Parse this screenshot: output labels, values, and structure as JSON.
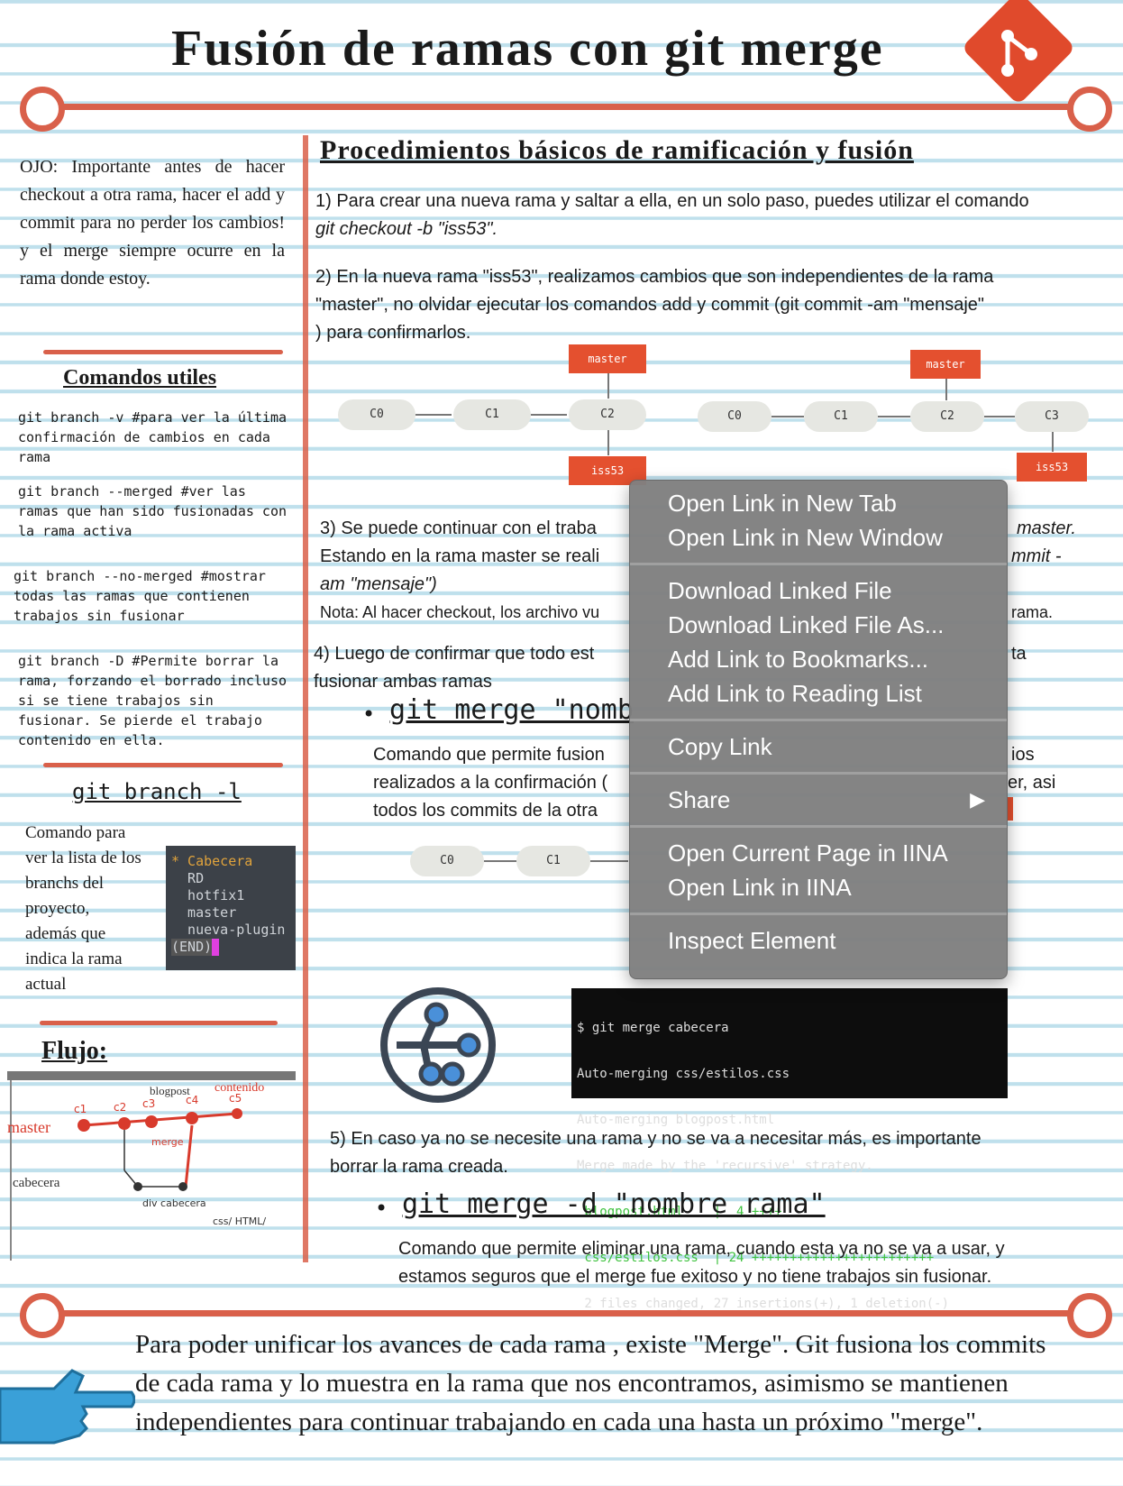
{
  "title": "Fusión de ramas con git merge",
  "left": {
    "note": "OJO: Importante antes de hacer checkout a otra rama, hacer el add y commit para no perder los cambios! y el merge siempre ocurre en la rama donde estoy.",
    "commands_title": "Comandos utiles",
    "cmd1": "git branch -v #para ver la última confirmación de cambios en cada rama",
    "cmd2": "git branch --merged #ver las ramas que han sido fusionadas con la rama activa",
    "cmd3": "git branch --no-merged #mostrar todas las ramas que contienen trabajos sin fusionar",
    "cmd4": "git branch -D #Permite borrar la rama, forzando el borrado incluso si se tiene trabajos sin fusionar. Se pierde el trabajo contenido en ella.",
    "branch_l_title": "git branch -l",
    "branch_l_desc": [
      "Comando para",
      "ver la lista de los",
      "branchs del",
      "proyecto,",
      "además que",
      "indica la rama",
      "actual"
    ],
    "branch_list": [
      "* Cabecera",
      "  RD",
      "  hotfix1",
      "  master",
      "  nueva-plugin",
      "(END)"
    ],
    "flujo_title": "Flujo:",
    "flow_labels": {
      "master": "master",
      "cabecera": "cabecera",
      "c1": "c1",
      "c2": "c2",
      "c3": "c3",
      "c4": "c4",
      "c5": "c5",
      "blogpost": "blogpost",
      "contenido": "contenido",
      "merge": "merge",
      "div_cabecera": "div cabecera",
      "css": "css/ HTML/"
    }
  },
  "main": {
    "section_title": "Procedimientos básicos de ramificación y fusión",
    "p1a": "1) Para crear una nueva rama y saltar a ella, en un solo paso, puedes utilizar el comando",
    "p1b": "git checkout -b \"iss53\".",
    "p2a": "2) En la nueva rama \"iss53\", realizamos cambios que son independientes de la rama",
    "p2b": "\"master\", no olvidar ejecutar los comandos add y commit (git commit -am \"mensaje\"",
    "p2c": ") para confirmarlos.",
    "p3a": "3) Se puede continuar con el traba",
    "p3a_r": "master.",
    "p3b": "Estando en la rama master se reali",
    "p3b_r": "mmit -",
    "p3c": "am \"mensaje\")",
    "p3d": "Nota: Al hacer checkout, los archivo vu",
    "p3d_r": "rama.",
    "p4a": "4) Luego de confirmar que todo est",
    "p4a_r": "ta",
    "p4b": "fusionar ambas ramas",
    "cmd_merge": "git merge \"nomb",
    "p4c": "Comando que permite fusion",
    "p4c_r": "ios",
    "p4d": "realizados a la confirmación (",
    "p4d_r": "er, asi",
    "p4e": "todos los commits de la otra",
    "p5a": "5) En caso ya no se necesite una rama y no se va a necesitar más, es importante",
    "p5b": "borrar la rama creada.",
    "cmd_delete": "git merge -d \"nombre rama\"",
    "p5c": "Comando que permite eliminar una rama, cuando esta ya no se va a usar, y",
    "p5d": "estamos seguros que el merge fue exitoso y no tiene trabajos sin fusionar.",
    "diagram1": {
      "nodes": [
        "C0",
        "C1",
        "C2"
      ],
      "top_tag": "master",
      "bottom_tag": "iss53"
    },
    "diagram2": {
      "nodes": [
        "C0",
        "C1",
        "C2",
        "C3"
      ],
      "top_tag": "master",
      "bottom_tag": "iss53"
    },
    "diagram3": {
      "nodes": [
        "C0",
        "C1"
      ]
    },
    "terminal": [
      "$ git merge cabecera",
      "Auto-merging css/estilos.css",
      "Auto-merging blogpost.html",
      "Merge made by the 'recursive' strategy.",
      " blogpost.html    |  4 ++++",
      " css/estilos.css  | 24 ++++++++++++++++++++++++",
      " 2 files changed, 27 insertions(+), 1 deletion(-)"
    ]
  },
  "bottom": {
    "summary": "Para poder unificar los avances de cada rama , existe \"Merge\". Git fusiona los commits de cada rama y lo muestra en la rama que nos encontramos, asimismo se mantienen independientes para continuar trabajando en cada una hasta un próximo \"merge\"."
  },
  "context_menu": {
    "group1": [
      "Open Link in New Tab",
      "Open Link in New Window"
    ],
    "group2": [
      "Download Linked File",
      "Download Linked File As...",
      "Add Link to Bookmarks...",
      "Add Link to Reading List"
    ],
    "group3": [
      "Copy Link"
    ],
    "group4": [
      "Share"
    ],
    "group5": [
      "Open Current Page in IINA",
      "Open Link in IINA"
    ],
    "group6": [
      "Inspect Element"
    ]
  },
  "colors": {
    "accent": "#d9604a",
    "git_orange": "#e4502f",
    "ruled": "#bfe0ec",
    "menu_bg": "#808080"
  },
  "icons": [
    "git-logo-icon",
    "pointing-hand-icon",
    "git-merge-circle-icon",
    "submenu-arrow-icon"
  ]
}
